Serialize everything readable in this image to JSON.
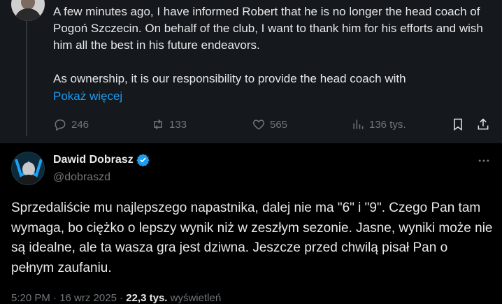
{
  "parent_tweet": {
    "paragraph1": "A few minutes ago, I have informed Robert that he is no longer the head coach of Pogoń Szczecin. On behalf of the club, I want to thank him for his efforts and wish him all the best in his future endeavors.",
    "paragraph2": "As ownership, it is our responsibility to provide the head coach with",
    "show_more": "Pokaż więcej",
    "actions": {
      "replies": "246",
      "reposts": "133",
      "likes": "565",
      "views": "136 tys."
    }
  },
  "reply_tweet": {
    "author_name": "Dawid Dobrasz",
    "handle": "@dobraszd",
    "text": "Sprzedaliście mu najlepszego napastnika, dalej nie ma \"6\" i \"9\". Czego Pan tam wymaga, bo ciężko o lepszy wynik niż w zeszłym sezonie. Jasne, wyniki może nie są idealne, ale ta wasza gra jest dziwna. Jeszcze przed chwilą pisał Pan o pełnym zaufaniu.",
    "meta_time": "5:20 PM · 16 wrz 2025 · ",
    "meta_views": "22,3 tys.",
    "meta_views_label": " wyświetleń"
  },
  "colors": {
    "accent": "#1d9bf0",
    "muted": "#71767b",
    "text": "#e7e9ea",
    "parent_bg": "#15181c"
  }
}
